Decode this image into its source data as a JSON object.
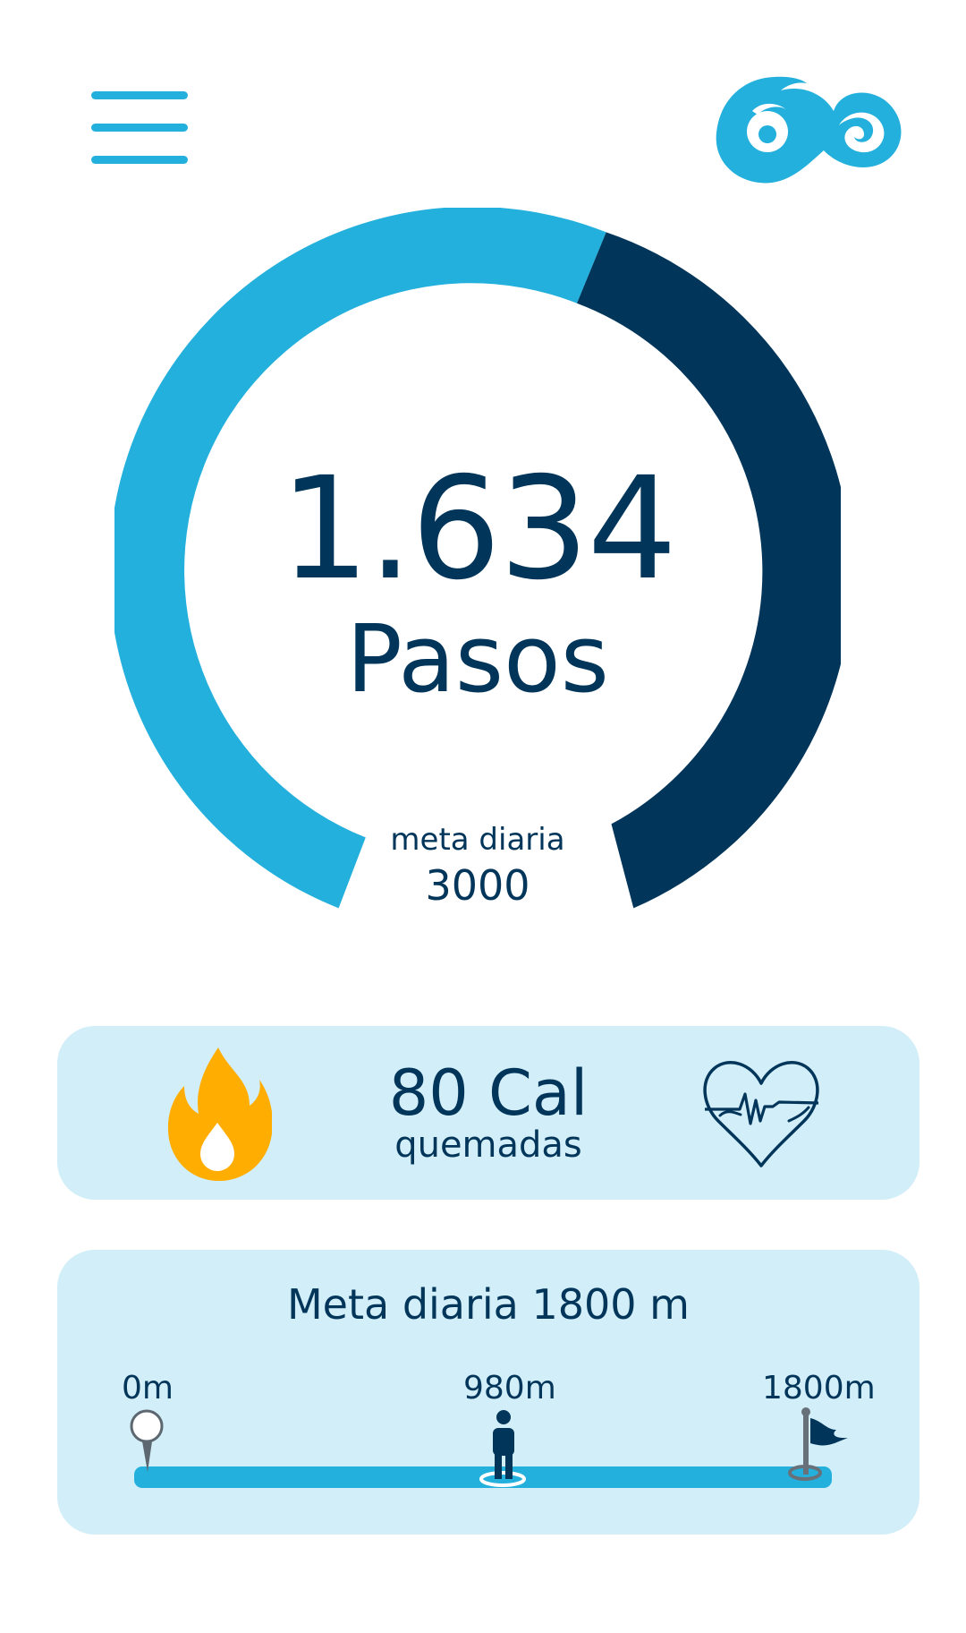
{
  "header": {
    "menu_icon": "hamburger-menu-icon",
    "logo_icon": "go-logo-icon"
  },
  "steps": {
    "value": "1.634",
    "label": "Pasos",
    "goal_label": "meta diaria",
    "goal_value": "3000",
    "progress_fraction": 0.545
  },
  "calories": {
    "value": "80 Cal",
    "label": "quemadas",
    "fire_icon": "fire-icon",
    "heart_icon": "heart-rate-icon"
  },
  "distance": {
    "title": "Meta diaria 1800 m",
    "start_label": "0m",
    "current_label": "980m",
    "end_label": "1800m",
    "progress_fraction": 0.544,
    "start_icon": "start-pin-icon",
    "current_icon": "walking-person-icon",
    "end_icon": "finish-flag-icon"
  },
  "colors": {
    "light_blue": "#24b0dc",
    "dark_blue": "#02355a",
    "card_background": "#d2eef8",
    "fire_orange": "#ffad00"
  }
}
